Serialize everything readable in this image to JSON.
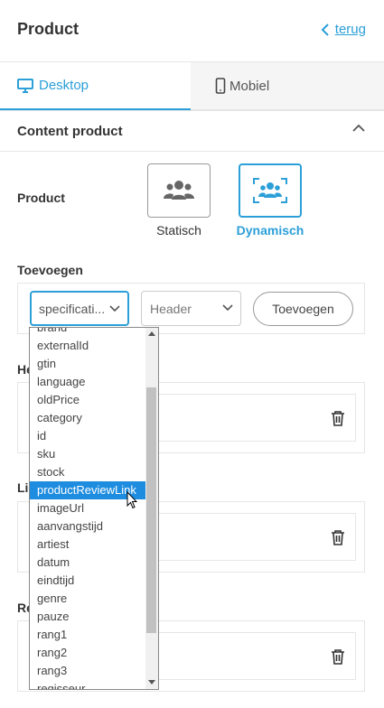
{
  "header": {
    "title": "Product",
    "back_label": "terug"
  },
  "tabs": [
    {
      "label": "Desktop",
      "icon": "monitor-icon",
      "active": true
    },
    {
      "label": "Mobiel",
      "icon": "mobile-icon",
      "active": false
    }
  ],
  "section": {
    "title": "Content product"
  },
  "product": {
    "label": "Product",
    "options": [
      {
        "label": "Statisch",
        "icon": "users-icon",
        "selected": false
      },
      {
        "label": "Dynamisch",
        "icon": "users-scan-icon",
        "selected": true
      }
    ]
  },
  "toevoegen": {
    "label": "Toevoegen",
    "field_value": "specificati...",
    "position_value": "Header",
    "button_label": "Toevoegen"
  },
  "groups": [
    {
      "label": "He"
    },
    {
      "label": "Li"
    },
    {
      "label": "Re"
    }
  ],
  "dropdown": {
    "items": [
      "brand",
      "externalId",
      "gtin",
      "language",
      "oldPrice",
      "category",
      "id",
      "sku",
      "stock",
      "productReviewLink",
      "imageUrl",
      "aanvangstijd",
      "artiest",
      "datum",
      "eindtijd",
      "genre",
      "pauze",
      "rang1",
      "rang2",
      "rang3",
      "regisseur"
    ],
    "selected": "productReviewLink"
  },
  "colors": {
    "accent": "#2b9fd8",
    "selection": "#1e8de0"
  }
}
